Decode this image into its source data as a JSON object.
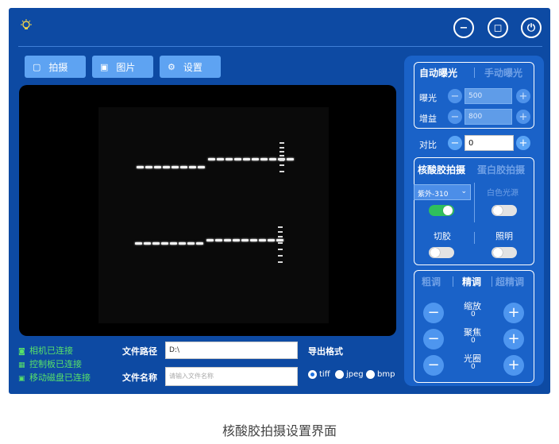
{
  "window": {
    "minimize_glyph": "−",
    "restore_glyph": "◻",
    "power_glyph": "⏻",
    "bulb_glyph": "💡"
  },
  "nav": {
    "capture_label": "拍摄",
    "images_label": "图片",
    "settings_label": "设置"
  },
  "status": {
    "camera": "相机已连接",
    "board": "控制板已连接",
    "disk": "移动磁盘已连接"
  },
  "file": {
    "path_label": "文件路径",
    "path_value": "D:\\",
    "name_label": "文件名称",
    "name_placeholder": "请输入文件名称",
    "export_label": "导出格式",
    "formats": [
      "tiff",
      "jpeg",
      "bmp"
    ],
    "selected_format": "tiff"
  },
  "exposure": {
    "auto_tab": "自动曝光",
    "manual_tab": "手动曝光",
    "exposure_label": "曝光",
    "exposure_value": "500",
    "gain_label": "增益",
    "gain_value": "800"
  },
  "contrast": {
    "label": "对比",
    "value": "0"
  },
  "gel": {
    "nucleic_tab": "核酸胶拍摄",
    "protein_tab": "蛋白胶拍摄",
    "uv_select": "紫外-310",
    "uv_on": true,
    "white_light_label": "白色光源",
    "white_light_on": false,
    "cut_label": "切胶",
    "cut_on": false,
    "illum_label": "照明",
    "illum_on": false
  },
  "adjust": {
    "coarse_tab": "粗调",
    "fine_tab": "精调",
    "superfine_tab": "超精调",
    "zoom_label": "缩放",
    "zoom_value": "0",
    "focus_label": "聚焦",
    "focus_value": "0",
    "aperture_label": "光圈",
    "aperture_value": "0"
  },
  "caption": "核酸胶拍摄设置界面"
}
